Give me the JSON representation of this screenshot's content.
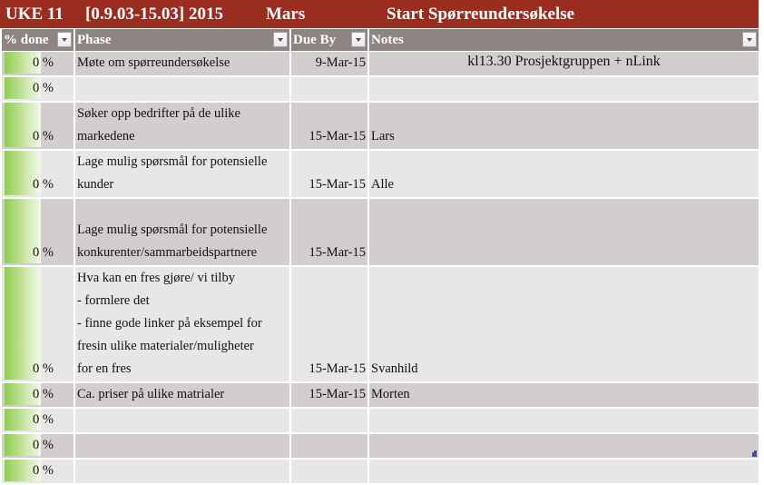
{
  "titlebar": {
    "week": "UKE 11",
    "range": "[0.9.03-15.03] 2015",
    "month": "Mars",
    "title": "Start Spørreundersøkelse"
  },
  "columns": [
    {
      "label": "% done",
      "filter_icon": "dropdown-arrow-icon"
    },
    {
      "label": "Phase",
      "filter_icon": "dropdown-arrow-icon"
    },
    {
      "label": "Due By",
      "filter_icon": "dropdown-arrow-icon"
    },
    {
      "label": "Notes",
      "filter_icon": "dropdown-arrow-icon"
    }
  ],
  "accent_colors": {
    "title_bar": "#9b2d20",
    "header": "#8d8483",
    "row_dark": "#d2cecd",
    "row_light": "#e8e6e7",
    "databar": "#8fcd4e"
  },
  "rows": [
    {
      "done": "0 %",
      "progress": 0,
      "phase": [
        "Møte om spørreundersøkelse"
      ],
      "due": "9-Mar-15",
      "notes": "kl13.30 Prosjektgruppen + nLink"
    },
    {
      "done": "0 %",
      "progress": 0,
      "phase": [],
      "due": "",
      "notes": ""
    },
    {
      "done": "0 %",
      "progress": 0,
      "phase": [
        "Søker opp bedrifter på de ulike",
        "markedene"
      ],
      "due": "15-Mar-15",
      "notes": "Lars"
    },
    {
      "done": "0 %",
      "progress": 0,
      "phase": [
        "Lage mulig  spørsmål for potensielle",
        "kunder"
      ],
      "due": "15-Mar-15",
      "notes": "Alle"
    },
    {
      "done": "0 %",
      "progress": 0,
      "phase": [
        "Lage mulig  spørsmål for potensielle",
        "konkurenter/sammarbeidspartnere"
      ],
      "due": "15-Mar-15",
      "notes": ""
    },
    {
      "done": "0 %",
      "progress": 0,
      "phase": [
        "Hva kan en fres gjøre/ vi tilby",
        "- formlere det",
        "- finne gode linker på  eksempel for",
        "fresin ulike materialer/muligheter",
        "for en fres"
      ],
      "due": "15-Mar-15",
      "notes": "Svanhild"
    },
    {
      "done": "0 %",
      "progress": 0,
      "phase": [
        "Ca. priser på ulike matrialer"
      ],
      "due": "15-Mar-15",
      "notes": "Morten"
    },
    {
      "done": "0 %",
      "progress": 0,
      "phase": [],
      "due": "",
      "notes": ""
    },
    {
      "done": "0 %",
      "progress": 0,
      "phase": [],
      "due": "",
      "notes": ""
    },
    {
      "done": "0 %",
      "progress": 0,
      "phase": [],
      "due": "",
      "notes": ""
    }
  ]
}
